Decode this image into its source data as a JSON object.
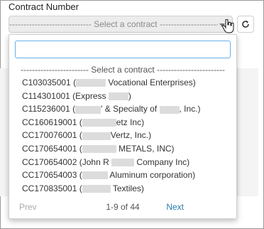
{
  "field": {
    "label": "Contract Number",
    "selected_value": "----------------------------- Select a contract -----------------------------"
  },
  "dropdown": {
    "search_placeholder": "",
    "header_option": "------------------------ Select a contract ------------------------",
    "options": [
      {
        "pre": "C103035001 (",
        "post": " Vocational Enterprises)"
      },
      {
        "pre": "C114301001 (Express ",
        "post": ")"
      },
      {
        "pre": "C115236001 (",
        "post": "' & Specialty of ",
        "post2": ", Inc.)"
      },
      {
        "pre": "CC160619001 (",
        "post": "etz Inc)"
      },
      {
        "pre": "CC170076001 (",
        "post": "Vertz, Inc.)"
      },
      {
        "pre": "CC170654001 (",
        "post": " METALS, INC)"
      },
      {
        "pre": "CC170654002 (John R ",
        "post": " Company Inc)"
      },
      {
        "pre": "CC170654003 (",
        "post": " Aluminum corporation)"
      },
      {
        "pre": "CC170835001 (",
        "post": " Textiles)"
      }
    ],
    "pager": {
      "prev": "Prev",
      "info": "1-9 of 44",
      "next": "Next"
    }
  }
}
